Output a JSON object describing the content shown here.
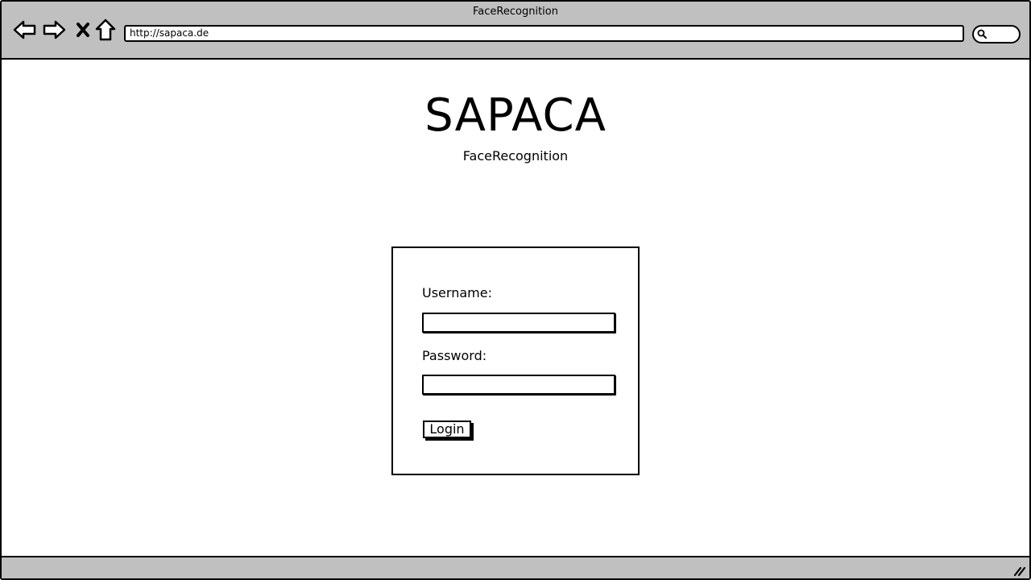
{
  "window": {
    "title": "FaceRecognition"
  },
  "toolbar": {
    "back_icon": "back-arrow-icon",
    "forward_icon": "forward-arrow-icon",
    "stop_icon": "close-icon",
    "home_icon": "home-icon",
    "url": "http://sapaca.de",
    "search_icon": "search-icon"
  },
  "header": {
    "title": "SAPACA",
    "subtitle": "FaceRecognition"
  },
  "login_form": {
    "username_label": "Username:",
    "username_value": "",
    "password_label": "Password:",
    "password_value": "",
    "login_label": "Login"
  },
  "colors": {
    "chrome": "#c0c0c0",
    "border": "#000000",
    "background": "#ffffff"
  }
}
